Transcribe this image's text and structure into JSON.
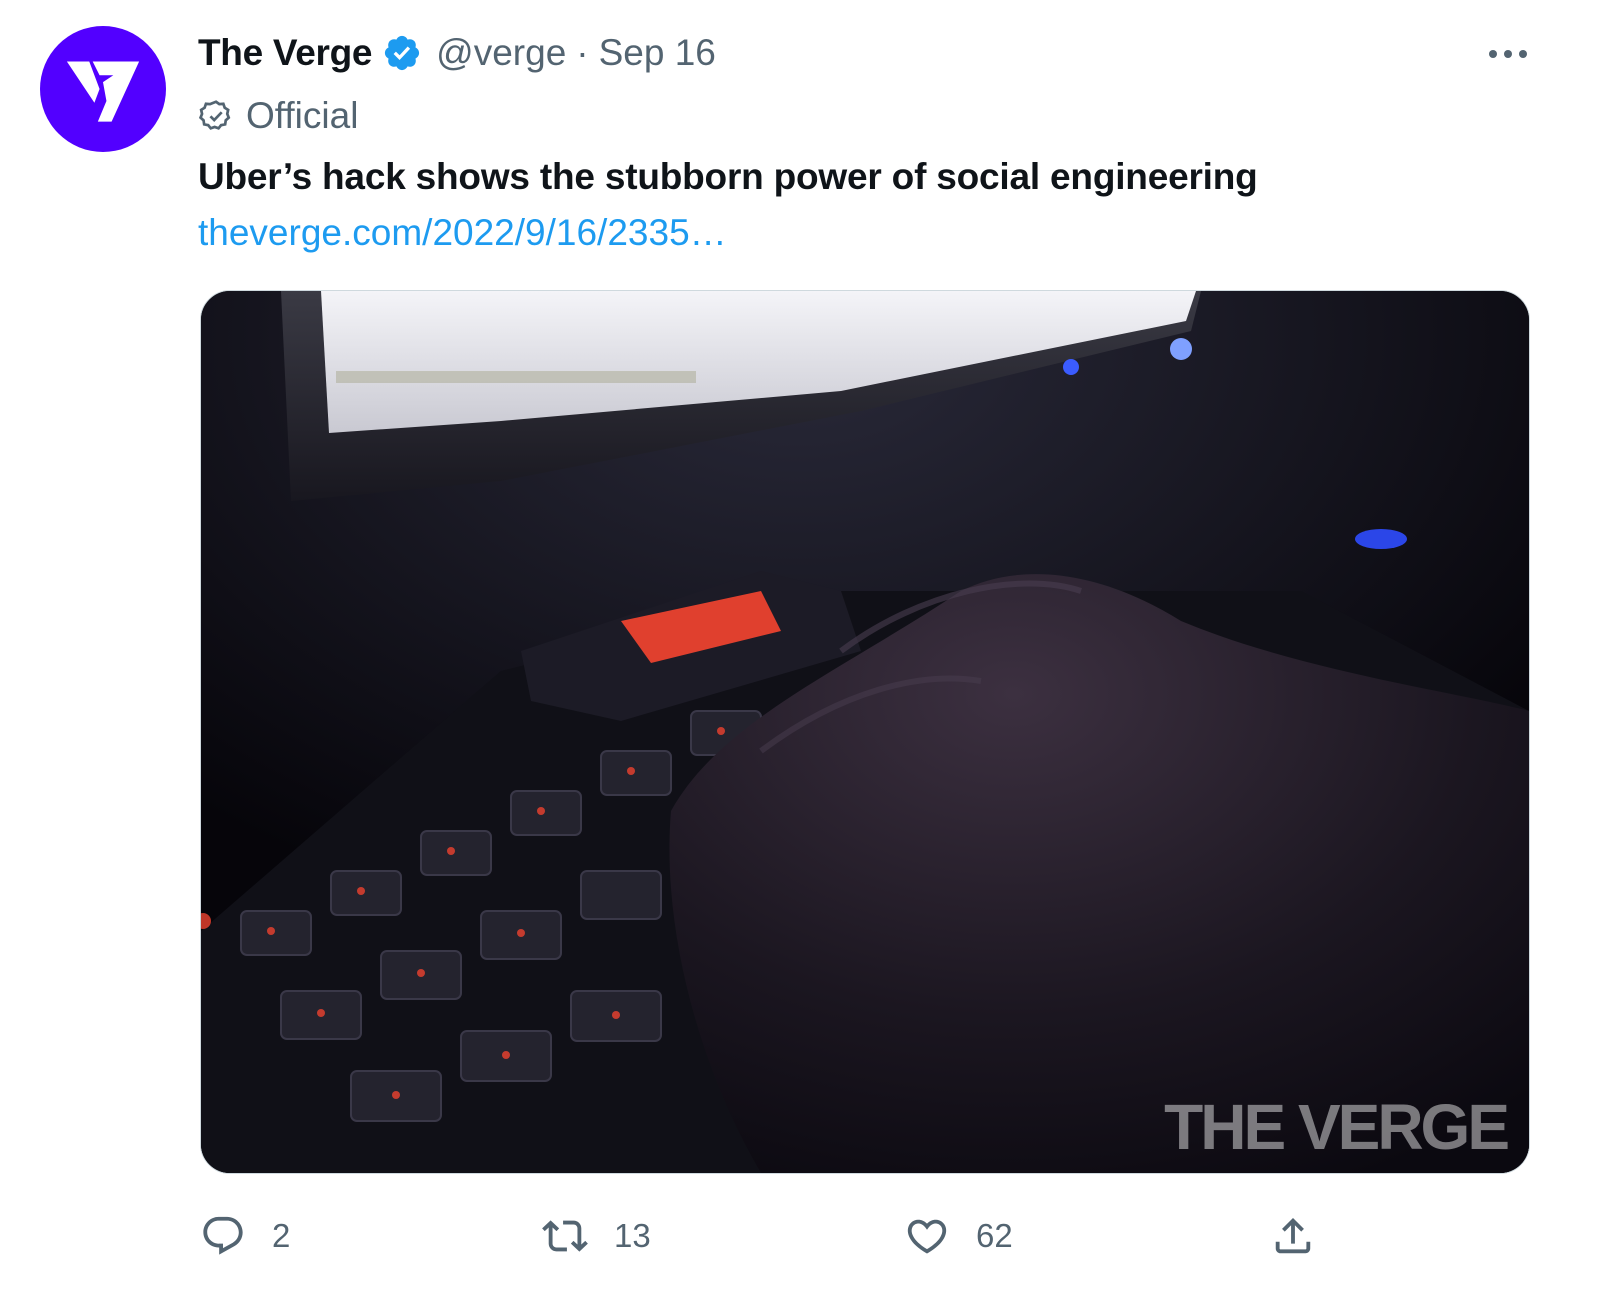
{
  "author": {
    "display_name": "The Verge",
    "handle": "@verge",
    "separator": "·",
    "timestamp": "Sep 16",
    "affiliation_label": "Official",
    "avatar_letter": "V"
  },
  "tweet": {
    "text": "Uber’s hack shows the stubborn power of social engineering",
    "link_text": "theverge.com/2022/9/16/2335…"
  },
  "media": {
    "watermark": "THE VERGE"
  },
  "actions": {
    "reply_count": "2",
    "retweet_count": "13",
    "like_count": "62"
  },
  "icons": {
    "verified": "verified-badge-icon",
    "affiliation": "official-badge-icon",
    "more": "more-icon",
    "reply": "reply-icon",
    "retweet": "retweet-icon",
    "like": "heart-icon",
    "share": "share-icon"
  },
  "colors": {
    "brand_purple": "#5200ff",
    "verified_blue": "#1d9bf0",
    "link_blue": "#1d9bf0",
    "secondary_text": "#536471",
    "primary_text": "#0f1419"
  }
}
